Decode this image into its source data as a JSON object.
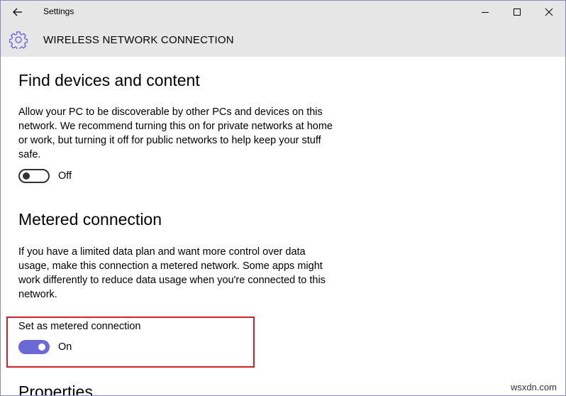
{
  "window": {
    "title": "Settings",
    "controls": {
      "minimize": "minimize-icon",
      "maximize": "maximize-icon",
      "close": "close-icon"
    }
  },
  "header": {
    "icon": "gear-icon",
    "title": "WIRELESS NETWORK CONNECTION"
  },
  "sections": {
    "find_devices": {
      "heading": "Find devices and content",
      "description": "Allow your PC to be discoverable by other PCs and devices on this network. We recommend turning this on for private networks at home or work, but turning it off for public networks to help keep your stuff safe.",
      "toggle_state": "Off"
    },
    "metered": {
      "heading": "Metered connection",
      "description": "If you have a limited data plan and want more control over data usage, make this connection a metered network. Some apps might work differently to reduce data usage when you're connected to this network.",
      "setting_label": "Set as metered connection",
      "toggle_state": "On"
    },
    "properties": {
      "heading": "Properties"
    }
  },
  "colors": {
    "accent": "#6b69d6",
    "highlight_border": "#d0202a",
    "chrome": "#e6e6e6"
  },
  "watermark": "wsxdn.com"
}
